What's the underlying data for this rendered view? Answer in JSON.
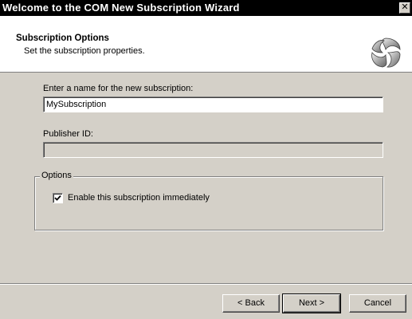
{
  "window": {
    "title": "Welcome to the COM New Subscription Wizard",
    "close_glyph": "✕"
  },
  "header": {
    "title": "Subscription Options",
    "subtitle": "Set the subscription properties.",
    "icon": "com-wizard-swirl-icon"
  },
  "form": {
    "name_label": "Enter a name for the new subscription:",
    "name_value": "MySubscription",
    "publisher_label": "Publisher ID:",
    "publisher_value": "",
    "options_group_label": "Options",
    "enable_checkbox_label": "Enable this subscription immediately",
    "enable_checked": true
  },
  "buttons": {
    "back": "< Back",
    "next": "Next >",
    "cancel": "Cancel"
  }
}
